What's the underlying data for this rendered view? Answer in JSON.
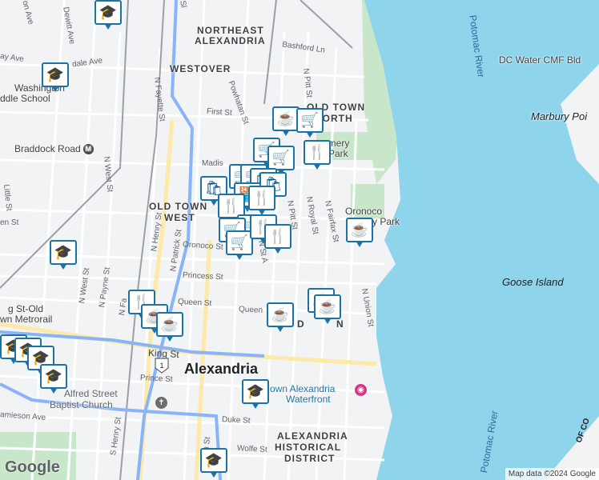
{
  "map": {
    "colors": {
      "land": "#f1f3f4",
      "water": "#8ed5ec",
      "park": "#c8e6c9",
      "road": "#ffffff",
      "arterial": "#fde9a8",
      "rail": "#9aa0a6",
      "highway": "#8ab4f8",
      "pin_border": "#1a73a8",
      "pin_icon": "#0b4c80"
    },
    "neighborhoods": [
      {
        "id": "northeast",
        "text": "NORTHEAST"
      },
      {
        "id": "alexandria-ne",
        "text": "ALEXANDRIA"
      },
      {
        "id": "westover",
        "text": "WESTOVER"
      },
      {
        "id": "old-town-north-a",
        "text": "OLD TOWN"
      },
      {
        "id": "old-town-north-b",
        "text": "NORTH"
      },
      {
        "id": "old-town-west-a",
        "text": "OLD TOWN"
      },
      {
        "id": "old-town-west-b",
        "text": "WEST"
      },
      {
        "id": "historical-a",
        "text": "ALEXANDRIA"
      },
      {
        "id": "historical-b",
        "text": "HISTORICAL"
      },
      {
        "id": "historical-c",
        "text": "DISTRICT"
      }
    ],
    "city": "Alexandria",
    "streets": [
      {
        "id": "dewitt",
        "text": "Dewitt Ave"
      },
      {
        "id": "on-ave",
        "text": "on Ave"
      },
      {
        "id": "ay-ave",
        "text": "ay Ave"
      },
      {
        "id": "dale-ave",
        "text": "dale Ave"
      },
      {
        "id": "bashford",
        "text": "Bashford Ln"
      },
      {
        "id": "n-fayette",
        "text": "N Fayette St"
      },
      {
        "id": "powhatan",
        "text": "Powhatan St"
      },
      {
        "id": "n-pitt-top",
        "text": "N Pitt St"
      },
      {
        "id": "first",
        "text": "First St"
      },
      {
        "id": "madison",
        "text": "Madis"
      },
      {
        "id": "n-west",
        "text": "N West St"
      },
      {
        "id": "little",
        "text": "Little St"
      },
      {
        "id": "en-st",
        "text": "en St"
      },
      {
        "id": "oronoco",
        "text": "Oronoco St"
      },
      {
        "id": "n-royal",
        "text": "N Royal St"
      },
      {
        "id": "n-fairfax",
        "text": "N Fairfax St"
      },
      {
        "id": "n-pitt-mid",
        "text": "N Pitt St"
      },
      {
        "id": "n-henry",
        "text": "N Henry St"
      },
      {
        "id": "n-patrick",
        "text": "N Patrick St"
      },
      {
        "id": "princess",
        "text": "Princess St"
      },
      {
        "id": "queen-w",
        "text": "Queen St"
      },
      {
        "id": "queen-e",
        "text": "Queen"
      },
      {
        "id": "n-st-a",
        "text": "N St A"
      },
      {
        "id": "n-west-low",
        "text": "N West St"
      },
      {
        "id": "n-payne",
        "text": "N Payne St"
      },
      {
        "id": "n-fa",
        "text": "N Fa"
      },
      {
        "id": "union",
        "text": "N Union St"
      },
      {
        "id": "king",
        "text": "King St"
      },
      {
        "id": "prince",
        "text": "Prince St"
      },
      {
        "id": "duke",
        "text": "Duke St"
      },
      {
        "id": "wolfe",
        "text": "Wolfe St"
      },
      {
        "id": "s-henry",
        "text": "S Henry St"
      },
      {
        "id": "on-st",
        "text": "on St"
      },
      {
        "id": "jamieson",
        "text": "amieson Ave"
      },
      {
        "id": "sl",
        "text": "Sl"
      }
    ],
    "pois": [
      {
        "id": "washington-a",
        "text": "Washington"
      },
      {
        "id": "washington-b",
        "text": "ddle School"
      },
      {
        "id": "braddock",
        "text": "Braddock Road"
      },
      {
        "id": "montgomery",
        "text": "omery"
      },
      {
        "id": "park",
        "text": "Park"
      },
      {
        "id": "oronoco-bay-a",
        "text": "Oronoco"
      },
      {
        "id": "oronoco-bay-b",
        "text": "y Park"
      },
      {
        "id": "king-metro-a",
        "text": "g St-Old"
      },
      {
        "id": "king-metro-b",
        "text": "wn Metrorail"
      },
      {
        "id": "alfred-a",
        "text": "Alfred Street"
      },
      {
        "id": "alfred-b",
        "text": "Baptist Church"
      },
      {
        "id": "waterfront-a",
        "text": "own Alexandria"
      },
      {
        "id": "waterfront-b",
        "text": "Waterfront"
      },
      {
        "id": "dc-water",
        "text": "DC Water CMF Bld"
      },
      {
        "id": "marbury",
        "text": "Marbury Poi"
      }
    ],
    "water_labels": [
      {
        "id": "potomac-top",
        "text": "Potomac River"
      },
      {
        "id": "potomac-bottom",
        "text": "Potomac River"
      },
      {
        "id": "goose",
        "text": "Goose Island"
      }
    ],
    "small_labels": [
      {
        "id": "d-n",
        "text": "D"
      },
      {
        "id": "d-n2",
        "text": "N"
      },
      {
        "id": "of-co",
        "text": "OF CO"
      }
    ],
    "route_shield": "1",
    "markers": [
      {
        "icon": "school",
        "glyph": "🎓"
      },
      {
        "icon": "school",
        "glyph": "🎓"
      },
      {
        "icon": "school",
        "glyph": "🎓"
      },
      {
        "icon": "school",
        "glyph": "🎓"
      },
      {
        "icon": "school",
        "glyph": "🎓"
      },
      {
        "icon": "school",
        "glyph": "🎓"
      },
      {
        "icon": "school",
        "glyph": "🎓"
      },
      {
        "icon": "school",
        "glyph": "🎓"
      },
      {
        "icon": "school",
        "glyph": "🎓"
      },
      {
        "icon": "coffee",
        "glyph": "☕"
      },
      {
        "icon": "grocery",
        "glyph": "🛒"
      },
      {
        "icon": "restaurant",
        "glyph": "🍴"
      },
      {
        "icon": "grocery",
        "glyph": "🛒"
      },
      {
        "icon": "grocery",
        "glyph": "🛒"
      },
      {
        "icon": "grocery",
        "glyph": "🛒"
      },
      {
        "icon": "grocery",
        "glyph": "🛒"
      },
      {
        "icon": "shopping",
        "glyph": "🛍"
      },
      {
        "icon": "shopping",
        "glyph": "🛍"
      },
      {
        "icon": "store",
        "glyph": "🏪"
      },
      {
        "icon": "shopping",
        "glyph": "🛍"
      },
      {
        "icon": "restaurant",
        "glyph": "🍴"
      },
      {
        "icon": "restaurant",
        "glyph": "🍴"
      },
      {
        "icon": "grocery",
        "glyph": "🛒"
      },
      {
        "icon": "grocery",
        "glyph": "🛒"
      },
      {
        "icon": "grocery",
        "glyph": "🛒"
      },
      {
        "icon": "restaurant",
        "glyph": "🍴"
      },
      {
        "icon": "restaurant",
        "glyph": "🍴"
      },
      {
        "icon": "restaurant",
        "glyph": "🍴"
      },
      {
        "icon": "coffee",
        "glyph": "☕"
      },
      {
        "icon": "coffee",
        "glyph": "☕"
      },
      {
        "icon": "coffee",
        "glyph": "☕"
      },
      {
        "icon": "coffee",
        "glyph": "☕"
      },
      {
        "icon": "coffee",
        "glyph": "☕"
      },
      {
        "icon": "coffee",
        "glyph": "☕"
      }
    ],
    "branding": {
      "logo": "Google",
      "attribution": "Map data ©2024 Google"
    }
  }
}
